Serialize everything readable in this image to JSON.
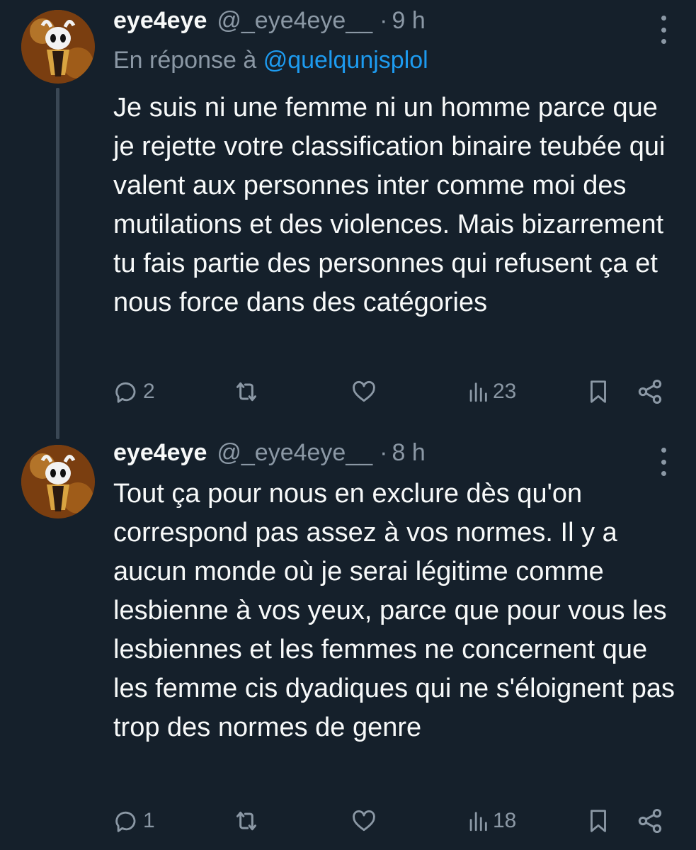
{
  "tweets": [
    {
      "author": {
        "name": "eye4eye",
        "handle": "@_eye4eye__"
      },
      "separator": "·",
      "time": "9 h",
      "reply_prefix": "En réponse à",
      "reply_mention": "@quelqunjsplol",
      "text": "Je suis ni une femme ni un homme parce que je rejette votre classification binaire teubée qui valent aux personnes inter comme moi des mutilations et des violences. Mais bizarrement tu fais partie des personnes qui refusent ça et nous force dans des catégories",
      "replies": "2",
      "views": "23"
    },
    {
      "author": {
        "name": "eye4eye",
        "handle": "@_eye4eye__"
      },
      "separator": "·",
      "time": "8 h",
      "text": "Tout ça pour nous en exclure dès qu'on correspond pas assez à vos normes. Il y a aucun monde où je serai légitime comme lesbienne à vos yeux, parce que pour vous les lesbiennes et les femmes ne concernent que les femme cis dyadiques qui ne s'éloignent pas trop des normes de genre",
      "replies": "1",
      "views": "18"
    }
  ],
  "colors": {
    "background": "#15202b",
    "text": "#f7f9f9",
    "secondary": "#8b98a5",
    "accent": "#1d9bf0"
  },
  "icons": [
    "more-icon",
    "reply-icon",
    "retweet-icon",
    "like-icon",
    "views-icon",
    "bookmark-icon",
    "share-icon"
  ]
}
